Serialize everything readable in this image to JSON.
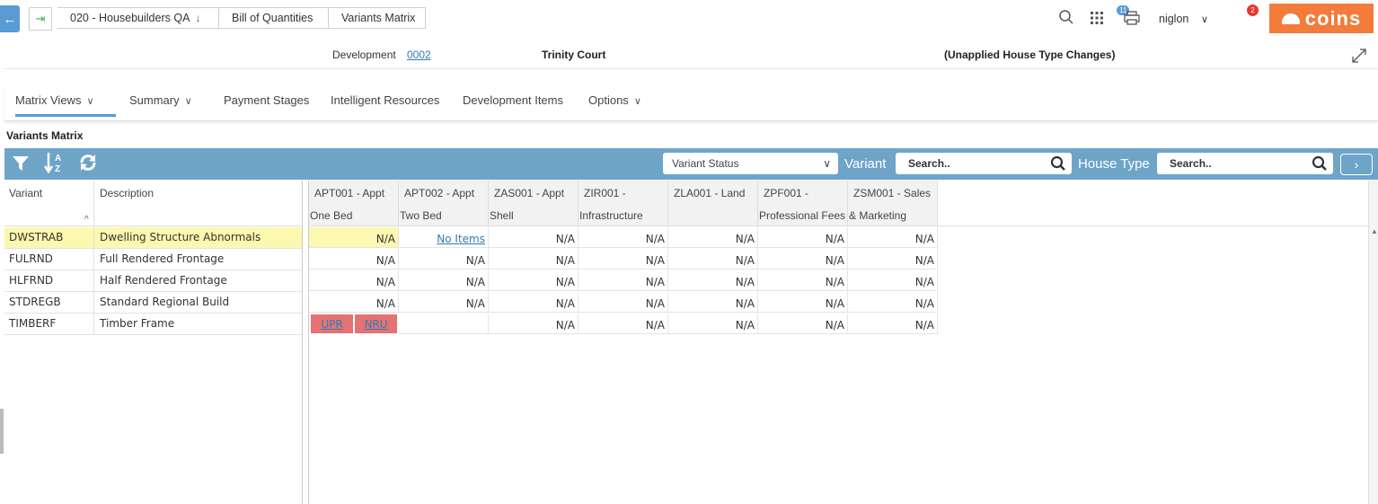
{
  "breadcrumbs": [
    {
      "label": "020 - Housebuilders QA",
      "dropdown": true
    },
    {
      "label": "Bill of Quantities"
    },
    {
      "label": "Variants Matrix"
    }
  ],
  "header": {
    "notifications_count": "11",
    "user": "niglon",
    "alerts_count": "2",
    "brand": "coins"
  },
  "info": {
    "development_label": "Development",
    "development_code": "0002",
    "development_name": "Trinity Court",
    "status_note": "(Unapplied House Type Changes)"
  },
  "menu": [
    {
      "label": "Matrix Views",
      "dropdown": true,
      "active": true
    },
    {
      "label": "Summary",
      "dropdown": true
    },
    {
      "label": "Payment Stages"
    },
    {
      "label": "Intelligent Resources"
    },
    {
      "label": "Development Items"
    },
    {
      "label": "Options",
      "dropdown": true
    }
  ],
  "section_title": "Variants Matrix",
  "toolbar": {
    "variant_status_placeholder": "Variant Status",
    "variant_label": "Variant",
    "variant_search": "Search..",
    "house_type_label": "House Type",
    "house_type_search": "Search.."
  },
  "left_columns": [
    "Variant",
    "Description"
  ],
  "variants": [
    {
      "code": "DWSTRAB",
      "description": "Dwelling Structure Abnormals"
    },
    {
      "code": "FULRND",
      "description": "Full Rendered Frontage"
    },
    {
      "code": "HLFRND",
      "description": "Half Rendered Frontage"
    },
    {
      "code": "STDREGB",
      "description": "Standard Regional Build"
    },
    {
      "code": "TIMBERF",
      "description": "Timber Frame"
    }
  ],
  "house_types": [
    {
      "line1": "APT001 - Appt",
      "line2": "One Bed"
    },
    {
      "line1": "APT002 - Appt",
      "line2": "Two Bed"
    },
    {
      "line1": "ZAS001 - Appt",
      "line2": "Shell"
    },
    {
      "line1": "ZIR001 -",
      "line2": "Infrastructure"
    },
    {
      "line1": "ZLA001 - Land",
      "line2": ""
    },
    {
      "line1": "ZPF001 -",
      "line2": "Professional Fees"
    },
    {
      "line1": "ZSM001 - Sales",
      "line2": "& Marketing"
    }
  ],
  "matrix": [
    [
      "N/A",
      "No Items",
      "N/A",
      "N/A",
      "N/A",
      "N/A",
      "N/A"
    ],
    [
      "N/A",
      "N/A",
      "N/A",
      "N/A",
      "N/A",
      "N/A",
      "N/A"
    ],
    [
      "N/A",
      "N/A",
      "N/A",
      "N/A",
      "N/A",
      "N/A",
      "N/A"
    ],
    [
      "N/A",
      "N/A",
      "N/A",
      "N/A",
      "N/A",
      "N/A",
      "N/A"
    ],
    [
      "",
      "",
      "N/A",
      "N/A",
      "N/A",
      "N/A",
      "N/A"
    ]
  ],
  "timberf_tags": [
    "UPR",
    "NRU"
  ],
  "colors": {
    "accent": "#5b9bd5",
    "toolbar": "#6fa4c9",
    "brand": "#f47b3a",
    "selected_row": "#fcf8b0",
    "tag": "#e57373"
  }
}
